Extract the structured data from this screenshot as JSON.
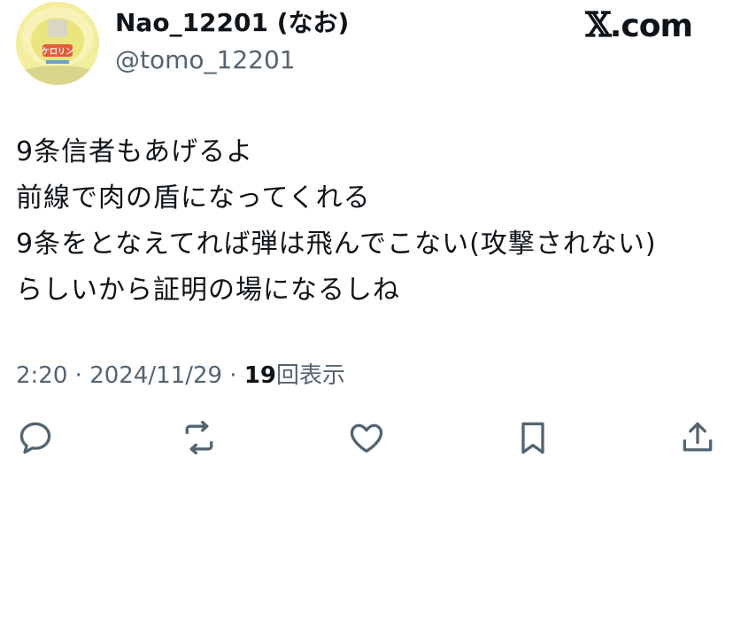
{
  "user": {
    "display_name": "Nao_12201 (なお)",
    "handle": "@tomo_12201",
    "avatar_icon": "avatar-image"
  },
  "brand": {
    "mark": "𝕏",
    "text": ".com"
  },
  "tweet": {
    "lines": [
      "9条信者もあげるよ",
      "前線で肉の盾になってくれる",
      "9条をとなえてれば弾は飛んでこない(攻撃されない)",
      "らしいから証明の場になるしね"
    ]
  },
  "meta": {
    "time": "2:20",
    "separator": " · ",
    "date": "2024/11/29",
    "views_count": "19",
    "views_label": "回表示"
  },
  "actions": {
    "reply_icon": "reply-icon",
    "repost_icon": "repost-icon",
    "like_icon": "heart-icon",
    "bookmark_icon": "bookmark-icon",
    "share_icon": "share-icon",
    "icon_color": "#536471"
  },
  "colors": {
    "text_primary": "#0f1419",
    "text_secondary": "#536471",
    "avatar_bg": "#f4ef9a"
  }
}
